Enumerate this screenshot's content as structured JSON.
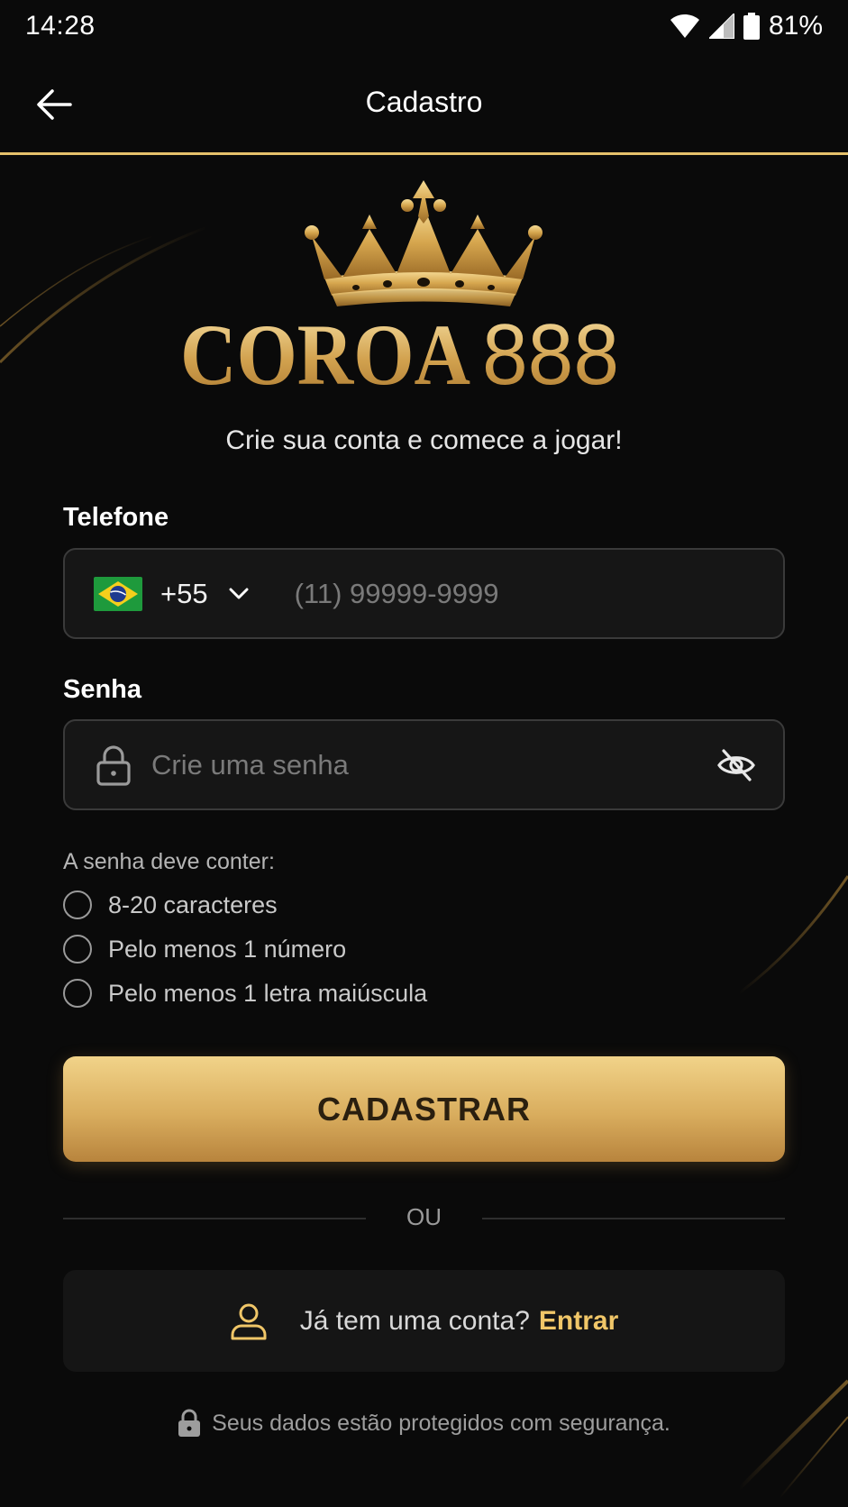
{
  "status_bar": {
    "time": "14:28",
    "battery": "81%",
    "icons": [
      "wifi-icon",
      "signal-icon",
      "battery-icon"
    ]
  },
  "app_bar": {
    "title": "Cadastro",
    "back_icon": "arrow-left-icon"
  },
  "logo": {
    "word": "COROA",
    "number": "888",
    "icon": "crown-icon"
  },
  "subtitle": "Crie sua conta e comece a jogar!",
  "phone": {
    "label": "Telefone",
    "country_flag": "brazil-flag-icon",
    "dial_code": "+55",
    "placeholder": "(11) 99999-9999",
    "value": ""
  },
  "password": {
    "label": "Senha",
    "placeholder": "Crie uma senha",
    "value": "",
    "rules_title": "A senha deve conter:",
    "rules": [
      "8-20 caracteres",
      "Pelo menos 1 número",
      "Pelo menos 1 letra maiúscula"
    ]
  },
  "submit_label": "CADASTRAR",
  "divider_text": "OU",
  "login": {
    "question": "Já tem uma conta?",
    "link": "Entrar"
  },
  "footer": "Seus dados estão protegidos com segurança.",
  "colors": {
    "background": "#0a0a0a",
    "accent_gold": "#e5c16b",
    "link_gold": "#f0c668",
    "field_bg": "#161616",
    "field_border": "#3a3a3a"
  }
}
